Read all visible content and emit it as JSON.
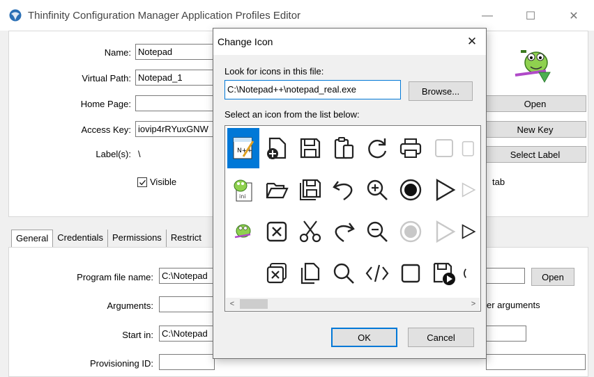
{
  "window": {
    "title": "Thinfinity Configuration Manager Application Profiles Editor",
    "minimize_glyph": "—",
    "maximize_glyph": "☐",
    "close_glyph": "✕"
  },
  "profile": {
    "name_label": "Name:",
    "name_value": "Notepad",
    "virtual_path_label": "Virtual Path:",
    "virtual_path_value": "Notepad_1",
    "home_page_label": "Home Page:",
    "home_page_value": "",
    "access_key_label": "Access Key:",
    "access_key_value": "iovip4rRYuxGNW",
    "labels_label": "Label(s):",
    "labels_value": "\\",
    "visible_label": "Visible",
    "visible_checked": true,
    "tab_option_suffix": "tab"
  },
  "right_buttons": {
    "open": "Open",
    "new_key": "New Key",
    "select_label": "Select Label"
  },
  "tabs": [
    {
      "label": "General",
      "active": true
    },
    {
      "label": "Credentials",
      "active": false
    },
    {
      "label": "Permissions",
      "active": false
    },
    {
      "label": "Restrict",
      "active": false
    }
  ],
  "general": {
    "program_file_label": "Program file name:",
    "program_file_value": "C:\\Notepad",
    "open_button": "Open",
    "arguments_label": "Arguments:",
    "arguments_value": "",
    "arguments_suffix": "er arguments",
    "start_in_label": "Start in:",
    "start_in_value": "C:\\Notepad",
    "provisioning_label": "Provisioning ID:",
    "provisioning_value": ""
  },
  "dialog": {
    "title": "Change Icon",
    "close_glyph": "✕",
    "look_label": "Look for icons in this file:",
    "file_value": "C:\\Notepad++\\notepad_real.exe",
    "browse_button": "Browse...",
    "select_label": "Select an icon from the list below:",
    "ok_button": "OK",
    "cancel_button": "Cancel",
    "scroll_left": "<",
    "scroll_right": ">"
  },
  "colors": {
    "selection": "#0078d7",
    "ok_border": "#0078d7"
  }
}
